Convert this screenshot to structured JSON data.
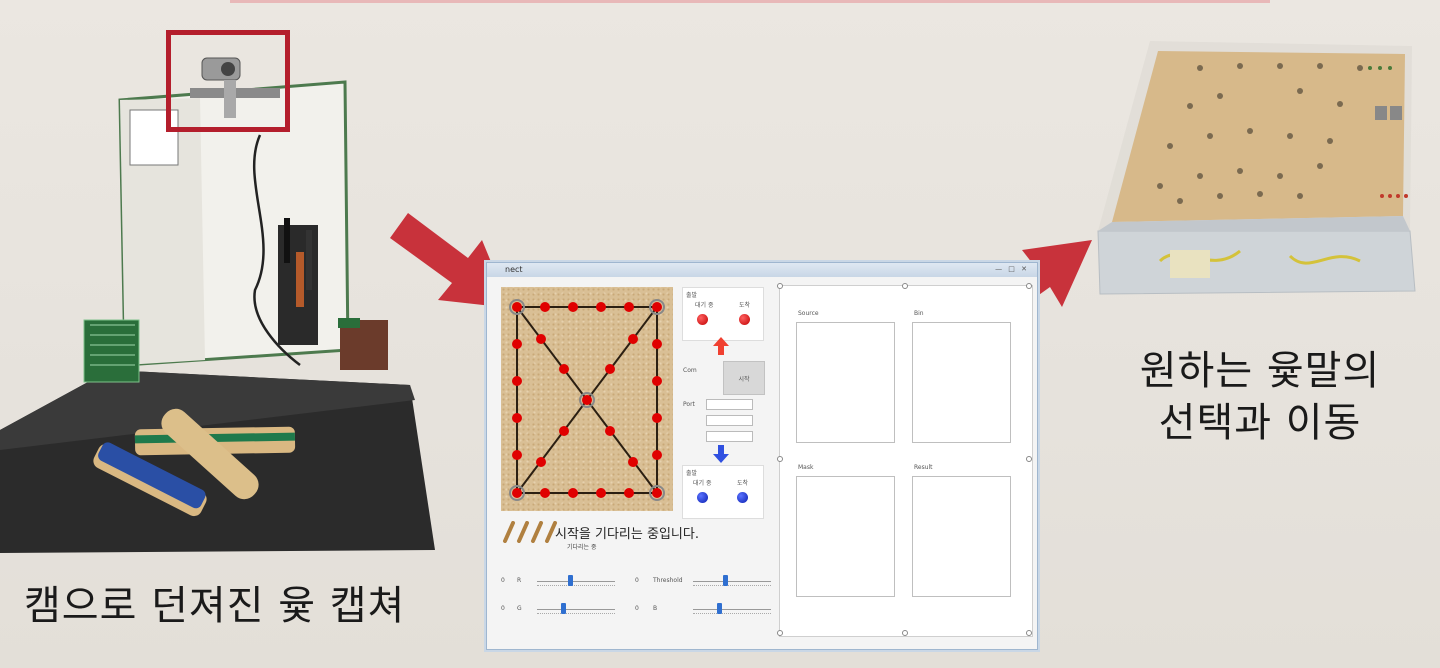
{
  "captions": {
    "left": "캠으로 던져진 윷 캡쳐",
    "right_line1": "원하는 윷말의",
    "right_line2": "선택과 이동"
  },
  "window": {
    "title": "nect",
    "controls": "— □ ✕",
    "top_panel": {
      "label": "출발",
      "left": "대기 중",
      "right": "도착"
    },
    "bottom_panel": {
      "label": "출발",
      "left": "대기 중",
      "right": "도착"
    },
    "com_label": "Com",
    "port_label": "Port",
    "start_button": "시작",
    "status": "시작을 기다리는 중입니다.",
    "status_sub": "기다리는 중",
    "sliders": [
      {
        "label_num": "0",
        "label": "R",
        "value": 0.4
      },
      {
        "label_num": "0",
        "label": "G",
        "value": 0.35
      },
      {
        "label_num": "0",
        "label": "Threshold",
        "value": 0.45
      },
      {
        "label_num": "0",
        "label": "B",
        "value": 0.35
      }
    ],
    "image_panels": [
      "Source",
      "Bin",
      "Mask",
      "Result"
    ]
  },
  "colors": {
    "arrow": "#c8323b",
    "highlight_box": "#b41e2c",
    "red_piece": "#d40000",
    "blue_piece": "#0a1fb0"
  },
  "icons": [
    "arrow-right-icon",
    "up-arrow-icon",
    "down-arrow-icon",
    "yut-sticks-icon"
  ]
}
